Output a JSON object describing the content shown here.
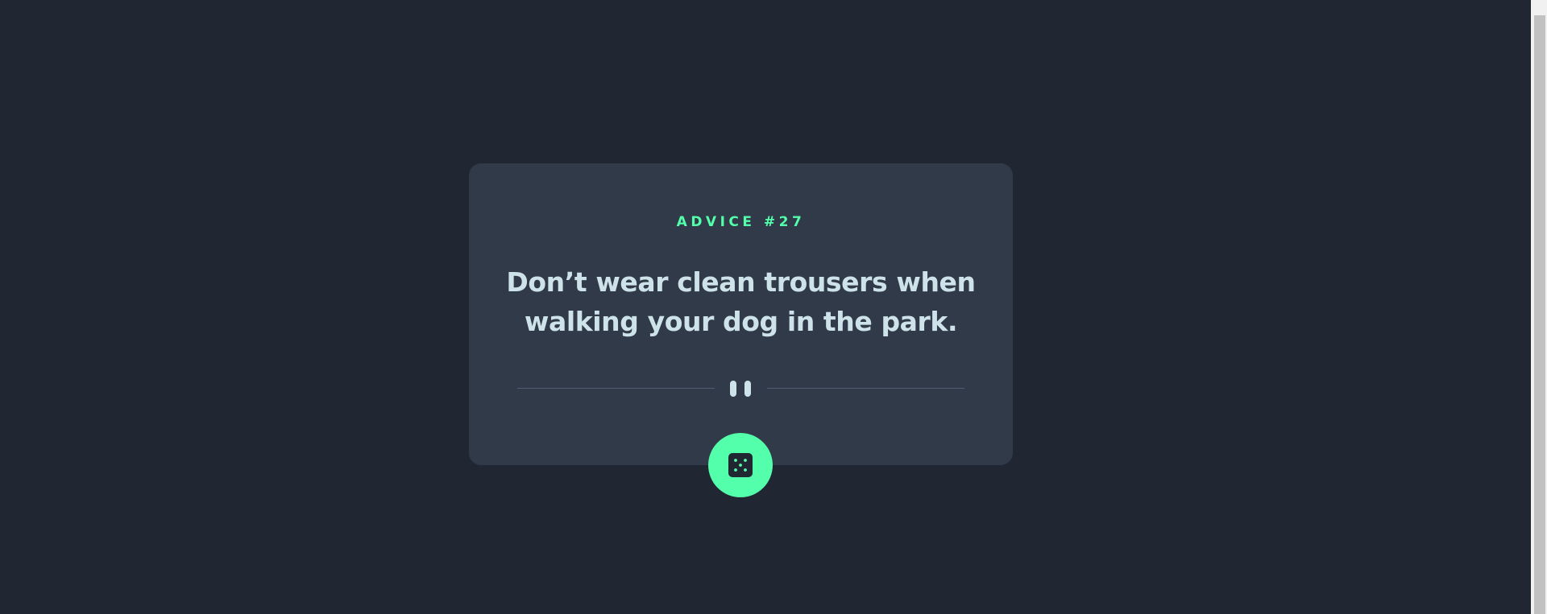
{
  "card": {
    "advice_label": "ADVICE #27",
    "advice_text": "Don’t wear clean trousers when walking your dog in the park."
  },
  "divider": {
    "icon": "pause-icon"
  },
  "button": {
    "icon": "dice-icon",
    "color": "#53ffaa"
  },
  "colors": {
    "background": "#202632",
    "card": "#313a48",
    "accent": "#53ffaa",
    "text": "#cee3e9",
    "divider": "#4f5d74"
  }
}
